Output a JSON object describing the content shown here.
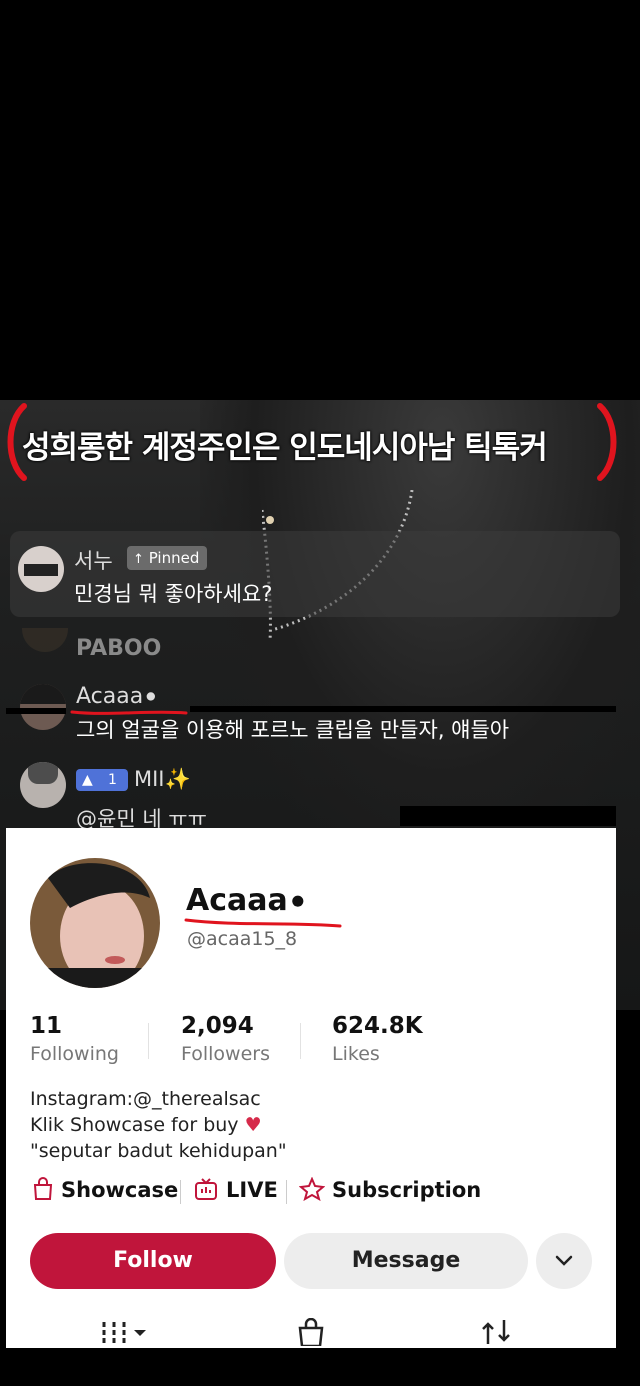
{
  "caption": {
    "text": "성희롱한 계정주인은 인도네시아남 틱톡커"
  },
  "chat": {
    "pinned": {
      "user": "서누",
      "badge": "Pinned",
      "message": "민경님 뭐 좋아하세요?"
    },
    "paboo": "PABOO",
    "comment": {
      "user": "Acaaa",
      "message": "그의 얼굴을 이용해 포르노 클립을 만들자, 얘들아"
    },
    "comment2": {
      "level": "1",
      "user": "MII",
      "message": "@윤민 네 ㅠㅠ"
    }
  },
  "profile": {
    "name": "Acaaa",
    "handle": "@acaa15_8",
    "stats": [
      {
        "value": "11",
        "label": "Following"
      },
      {
        "value": "2,094",
        "label": "Followers"
      },
      {
        "value": "624.8K",
        "label": "Likes"
      }
    ],
    "bio": [
      "Instagram:@_therealsac",
      "Klik Showcase for buy",
      "\"seputar badut kehidupan\""
    ],
    "links": {
      "showcase": "Showcase",
      "live": "LIVE",
      "subscription": "Subscription"
    },
    "buttons": {
      "follow": "Follow",
      "message": "Message"
    }
  },
  "colors": {
    "follow": "#c0153b",
    "annotation": "#e0141e",
    "level_badge": "#4f72d8"
  },
  "icons": [
    "pinned-icon",
    "apple-icon",
    "sparkle-icon",
    "lips-icon",
    "bag-icon",
    "live-icon",
    "subscription-icon",
    "chevron-down-icon",
    "grid-icon",
    "shop-icon",
    "repost-icon"
  ]
}
